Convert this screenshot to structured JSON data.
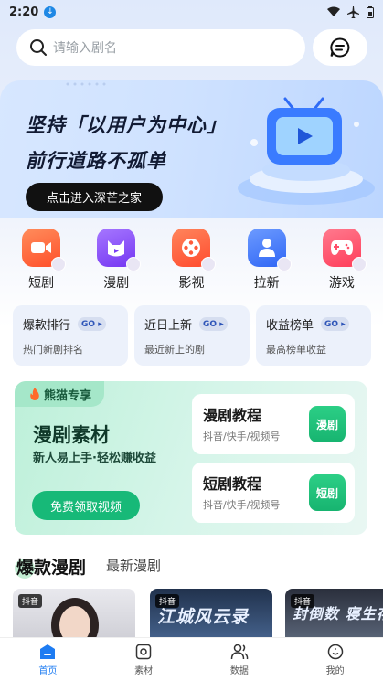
{
  "status_bar": {
    "time": "2:20"
  },
  "search": {
    "placeholder": "请输入剧名"
  },
  "banner": {
    "line1": "坚持「以用户为中心」",
    "line2": "前行道路不孤单",
    "cta": "点击进入深芒之家"
  },
  "quick_nav": [
    {
      "label": "短剧",
      "icon": "video-camera-icon",
      "color": "#ff6a3d"
    },
    {
      "label": "漫剧",
      "icon": "comic-face-icon",
      "color": "#8b4dff"
    },
    {
      "label": "影视",
      "icon": "film-reel-icon",
      "color": "#ff5a3a"
    },
    {
      "label": "拉新",
      "icon": "user-add-icon",
      "color": "#3d7bff"
    },
    {
      "label": "游戏",
      "icon": "gamepad-icon",
      "color": "#ff4f6a"
    }
  ],
  "rank_cards": [
    {
      "title": "爆款排行",
      "go": "GO",
      "sub": "热门新剧排名"
    },
    {
      "title": "近日上新",
      "go": "GO",
      "sub": "最近新上的剧"
    },
    {
      "title": "收益榜单",
      "go": "GO",
      "sub": "最高榜单收益"
    }
  ],
  "material": {
    "tag": "熊猫专享",
    "title": "漫剧素材",
    "subtitle": "新人易上手·轻松赚收益",
    "cta": "免费领取视频",
    "tutorials": [
      {
        "title": "漫剧教程",
        "sub": "抖音/快手/视频号",
        "btn": "漫剧"
      },
      {
        "title": "短剧教程",
        "sub": "抖音/快手/视频号",
        "btn": "短剧"
      }
    ]
  },
  "feed_tabs": {
    "active": "爆款漫剧",
    "inactive": "最新漫剧"
  },
  "posters": [
    {
      "tag": "抖音",
      "text": ""
    },
    {
      "tag": "抖音",
      "text": "江城风云录"
    },
    {
      "tag": "抖音",
      "text": "封倒数 寝生存游"
    }
  ],
  "bottom_nav": [
    {
      "label": "首页",
      "active": true
    },
    {
      "label": "素材",
      "active": false
    },
    {
      "label": "数据",
      "active": false
    },
    {
      "label": "我的",
      "active": false
    }
  ]
}
